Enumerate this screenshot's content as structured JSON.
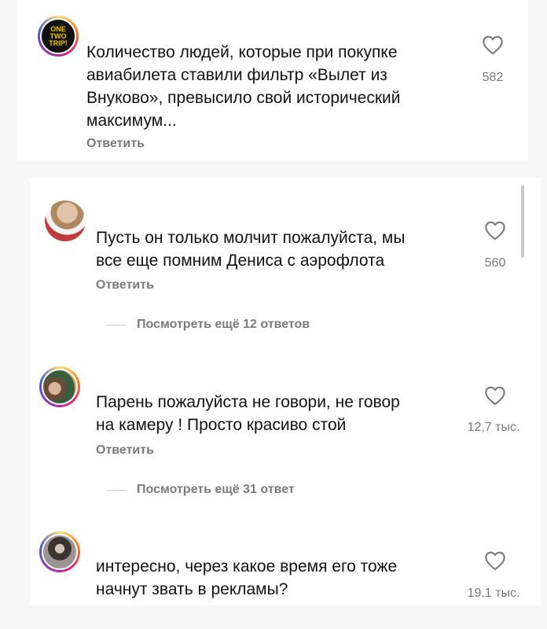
{
  "comments": [
    {
      "text": "Количество людей, которые при покупке\nавиабилета ставили фильтр «Вылет из\nВнуково», превысило свой исторический\nмаксимум...",
      "reply_label": "Ответить",
      "likes": "582",
      "avatar_logo": "ONE TWO TRIP!"
    },
    {
      "text": "Пусть он только молчит пожалуйста, мы\nвсе еще помним Дениса с аэрофлота",
      "reply_label": "Ответить",
      "likes": "560",
      "more_replies": "Посмотреть ещё 12 ответов"
    },
    {
      "text": "Парень пожалуйста не говори, не говор\nна камеру ! Просто красиво стой",
      "reply_label": "Ответить",
      "likes": "12,7 тыс.",
      "more_replies": "Посмотреть ещё 31 ответ"
    },
    {
      "text": "интересно, через какое время его тоже\nначнут звать в рекламы?",
      "likes": "19,1 тыс."
    }
  ],
  "icons": {
    "like": "heart-outline-icon"
  },
  "colors": {
    "text": "#121212",
    "muted": "#7a7a7a",
    "logo_bg": "#111111",
    "logo_text": "#f5c400"
  }
}
